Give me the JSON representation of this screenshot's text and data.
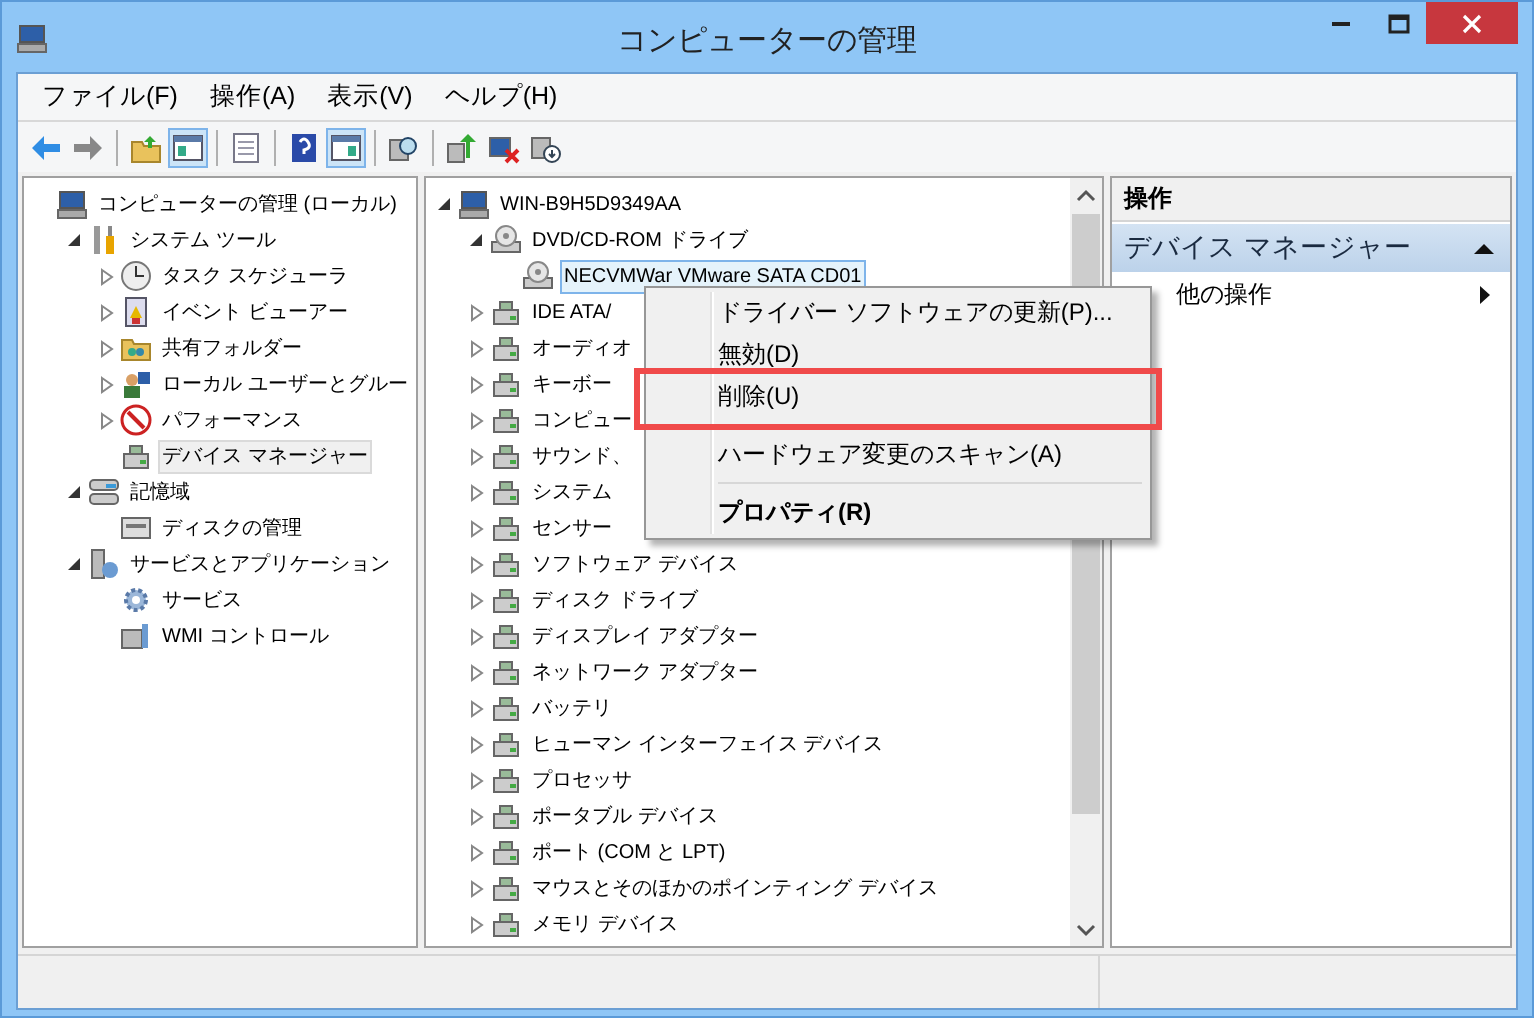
{
  "window": {
    "title": "コンピューターの管理"
  },
  "menu_bar": [
    {
      "label": "ファイル(F)"
    },
    {
      "label": "操作(A)"
    },
    {
      "label": "表示(V)"
    },
    {
      "label": "ヘルプ(H)"
    }
  ],
  "toolbar": [
    {
      "kind": "button",
      "pressed": false
    },
    {
      "kind": "button",
      "pressed": false
    },
    {
      "kind": "separator"
    },
    {
      "kind": "button",
      "pressed": false
    },
    {
      "kind": "button",
      "pressed": true
    },
    {
      "kind": "separator"
    },
    {
      "kind": "button",
      "pressed": false
    },
    {
      "kind": "separator"
    },
    {
      "kind": "button",
      "pressed": false
    },
    {
      "kind": "button",
      "pressed": true
    },
    {
      "kind": "separator"
    },
    {
      "kind": "button",
      "pressed": false
    },
    {
      "kind": "separator"
    },
    {
      "kind": "button",
      "pressed": false
    },
    {
      "kind": "button",
      "pressed": false
    },
    {
      "kind": "button",
      "pressed": false
    }
  ],
  "console_tree": {
    "items": [
      {
        "label": "コンピューターの管理 (ローカル)",
        "selected": false,
        "children": [
          {
            "label": "システム ツール",
            "expanded": true,
            "selected": false,
            "children": [
              {
                "label": "タスク スケジューラ",
                "expanded": false,
                "selected": false
              },
              {
                "label": "イベント ビューアー",
                "expanded": false,
                "selected": false
              },
              {
                "label": "共有フォルダー",
                "expanded": false,
                "selected": false
              },
              {
                "label": "ローカル ユーザーとグルー",
                "expanded": false,
                "selected": false
              },
              {
                "label": "パフォーマンス",
                "expanded": false,
                "selected": false
              },
              {
                "label": "デバイス マネージャー",
                "selected": true
              }
            ]
          },
          {
            "label": "記憶域",
            "expanded": true,
            "selected": false,
            "children": [
              {
                "label": "ディスクの管理",
                "selected": false
              }
            ]
          },
          {
            "label": "サービスとアプリケーション",
            "expanded": true,
            "selected": false,
            "children": [
              {
                "label": "サービス",
                "selected": false
              },
              {
                "label": "WMI コントロール",
                "selected": false
              }
            ]
          }
        ]
      }
    ]
  },
  "device_tree": {
    "items": [
      {
        "label": "WIN-B9H5D9349AA",
        "expanded": true,
        "selected": false,
        "children": [
          {
            "label": "DVD/CD-ROM ドライブ",
            "expanded": true,
            "selected": false,
            "children": [
              {
                "label": "NECVMWar VMware SATA CD01",
                "selected": true
              }
            ]
          },
          {
            "label": "IDE ATA/",
            "expanded": false,
            "selected": false
          },
          {
            "label": "オーディオ",
            "expanded": false,
            "selected": false
          },
          {
            "label": "キーボー",
            "expanded": false,
            "selected": false
          },
          {
            "label": "コンピュー",
            "expanded": false,
            "selected": false
          },
          {
            "label": "サウンド、",
            "expanded": false,
            "selected": false
          },
          {
            "label": "システム",
            "expanded": false,
            "selected": false
          },
          {
            "label": "センサー",
            "expanded": false,
            "selected": false
          },
          {
            "label": "ソフトウェア デバイス",
            "expanded": false,
            "selected": false
          },
          {
            "label": "ディスク ドライブ",
            "expanded": false,
            "selected": false
          },
          {
            "label": "ディスプレイ アダプター",
            "expanded": false,
            "selected": false
          },
          {
            "label": "ネットワーク アダプター",
            "expanded": false,
            "selected": false
          },
          {
            "label": "バッテリ",
            "expanded": false,
            "selected": false
          },
          {
            "label": "ヒューマン インターフェイス デバイス",
            "expanded": false,
            "selected": false
          },
          {
            "label": "プロセッサ",
            "expanded": false,
            "selected": false
          },
          {
            "label": "ポータブル デバイス",
            "expanded": false,
            "selected": false
          },
          {
            "label": "ポート (COM と LPT)",
            "expanded": false,
            "selected": false
          },
          {
            "label": "マウスとそのほかのポインティング デバイス",
            "expanded": false,
            "selected": false
          },
          {
            "label": "メモリ デバイス",
            "expanded": false,
            "selected": false
          }
        ]
      }
    ]
  },
  "context_menu": [
    {
      "kind": "item",
      "label": "ドライバー ソフトウェアの更新(P)...",
      "default": false,
      "outlined": false
    },
    {
      "kind": "item",
      "label": "無効(D)",
      "default": false,
      "outlined": false
    },
    {
      "kind": "item",
      "label": "削除(U)",
      "default": false,
      "outlined": true
    },
    {
      "kind": "separator"
    },
    {
      "kind": "item",
      "label": "ハードウェア変更のスキャン(A)",
      "default": false,
      "outlined": false
    },
    {
      "kind": "separator"
    },
    {
      "kind": "item",
      "label": "プロパティ(R)",
      "default": true,
      "outlined": false
    }
  ],
  "actions": {
    "header": "操作",
    "sections": [
      {
        "title": "デバイス マネージャー",
        "expanded": true,
        "items": [
          {
            "label": "他の操作",
            "submenu": true
          }
        ]
      }
    ]
  }
}
